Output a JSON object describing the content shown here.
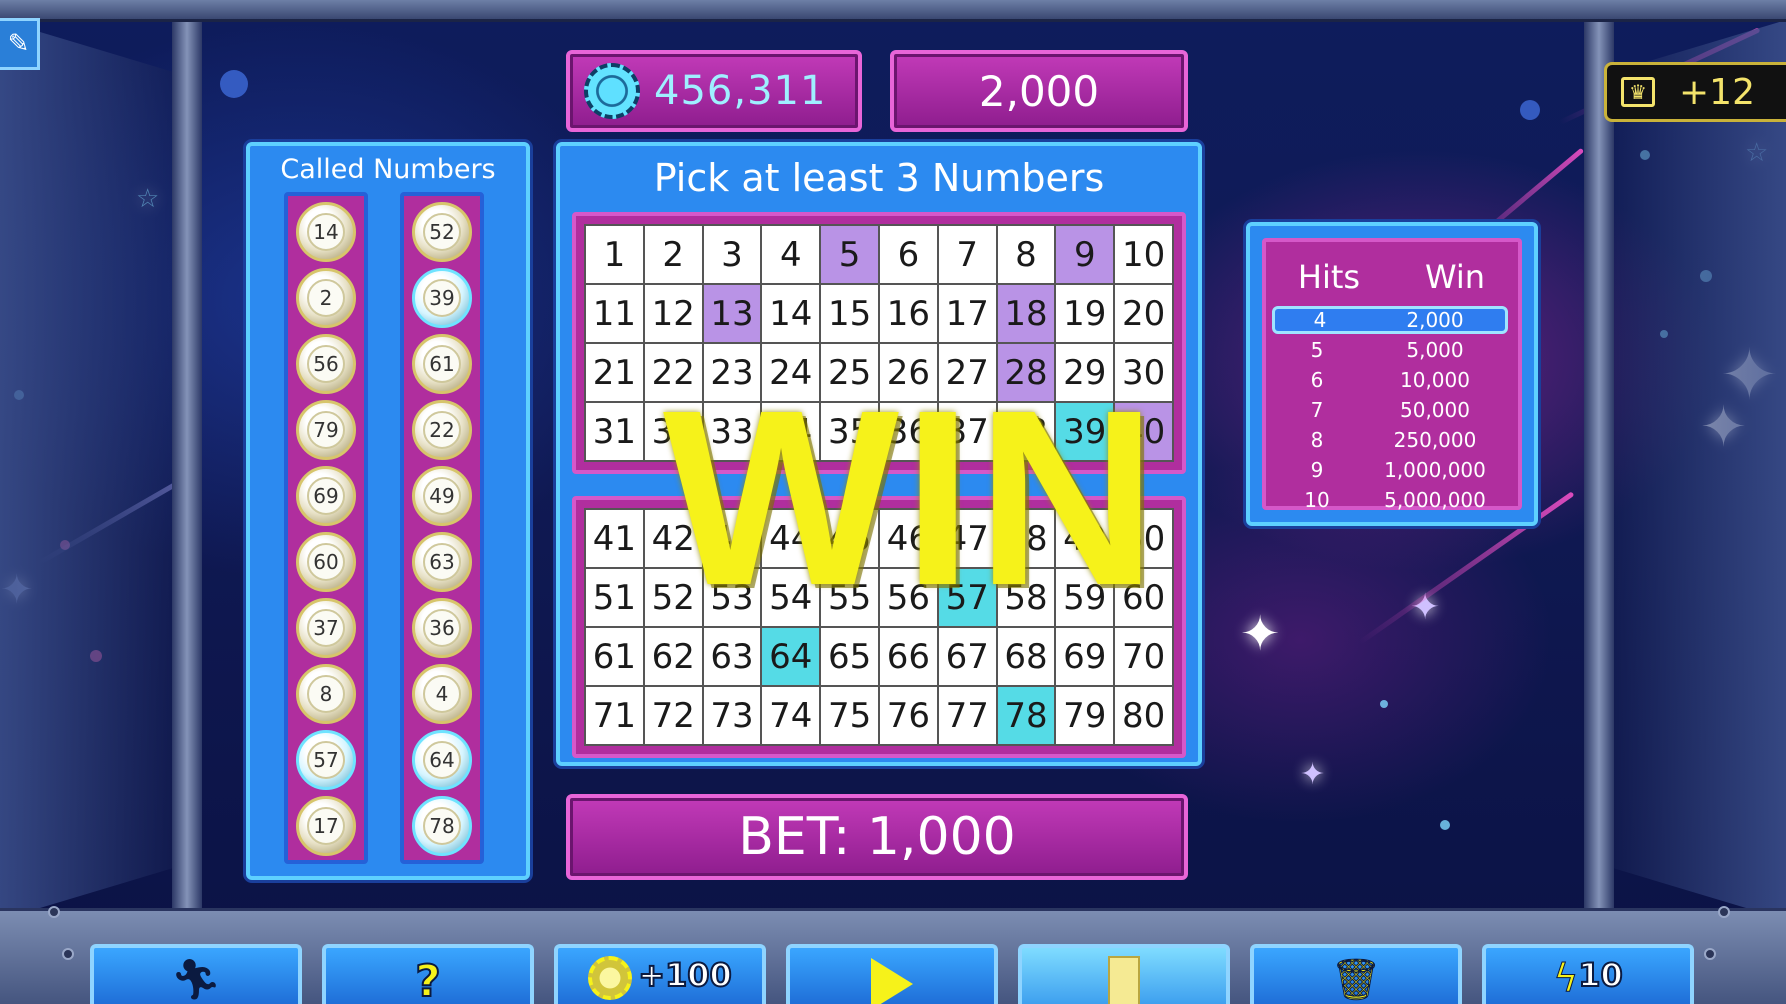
{
  "header": {
    "coins": "456,311",
    "win_amount": "2,000",
    "crown_bonus": "+12"
  },
  "called": {
    "title": "Called Numbers",
    "left": [
      {
        "n": "14",
        "hit": false
      },
      {
        "n": "2",
        "hit": false
      },
      {
        "n": "56",
        "hit": false
      },
      {
        "n": "79",
        "hit": false
      },
      {
        "n": "69",
        "hit": false
      },
      {
        "n": "60",
        "hit": false
      },
      {
        "n": "37",
        "hit": false
      },
      {
        "n": "8",
        "hit": false
      },
      {
        "n": "57",
        "hit": true
      },
      {
        "n": "17",
        "hit": false
      }
    ],
    "right": [
      {
        "n": "52",
        "hit": false
      },
      {
        "n": "39",
        "hit": true
      },
      {
        "n": "61",
        "hit": false
      },
      {
        "n": "22",
        "hit": false
      },
      {
        "n": "49",
        "hit": false
      },
      {
        "n": "63",
        "hit": false
      },
      {
        "n": "36",
        "hit": false
      },
      {
        "n": "4",
        "hit": false
      },
      {
        "n": "64",
        "hit": true
      },
      {
        "n": "78",
        "hit": true
      }
    ]
  },
  "board": {
    "title": "Pick at least 3 Numbers",
    "numbers_min": 1,
    "numbers_max": 80,
    "picked_not_hit": [
      5,
      9,
      13,
      18,
      28,
      40
    ],
    "hits": [
      39,
      57,
      64,
      78
    ],
    "overlay_text": "WIN"
  },
  "paytable": {
    "col_hits": "Hits",
    "col_win": "Win",
    "rows": [
      {
        "hits": "4",
        "win": "2,000",
        "active": true
      },
      {
        "hits": "5",
        "win": "5,000",
        "active": false
      },
      {
        "hits": "6",
        "win": "10,000",
        "active": false
      },
      {
        "hits": "7",
        "win": "50,000",
        "active": false
      },
      {
        "hits": "8",
        "win": "250,000",
        "active": false
      },
      {
        "hits": "9",
        "win": "1,000,000",
        "active": false
      },
      {
        "hits": "10",
        "win": "5,000,000",
        "active": false
      }
    ]
  },
  "bet": {
    "label": "BET: 1,000"
  },
  "toolbar": {
    "exit_icon": "running-man-exit-icon",
    "help_icon": "question-mark-icon",
    "coins_label": "+100",
    "play_icon": "play-icon",
    "quick_pick_icon": "yellow-card-icon",
    "clear_icon": "trash-can-icon",
    "auto_label": "10",
    "auto_icon": "lightning-icon"
  },
  "colors": {
    "picked": "#b993e6",
    "hit": "#55dbe6",
    "win_text": "#f6f21a",
    "panel_blue": "#2c8af0",
    "panel_magenta": "#b02e9e"
  }
}
